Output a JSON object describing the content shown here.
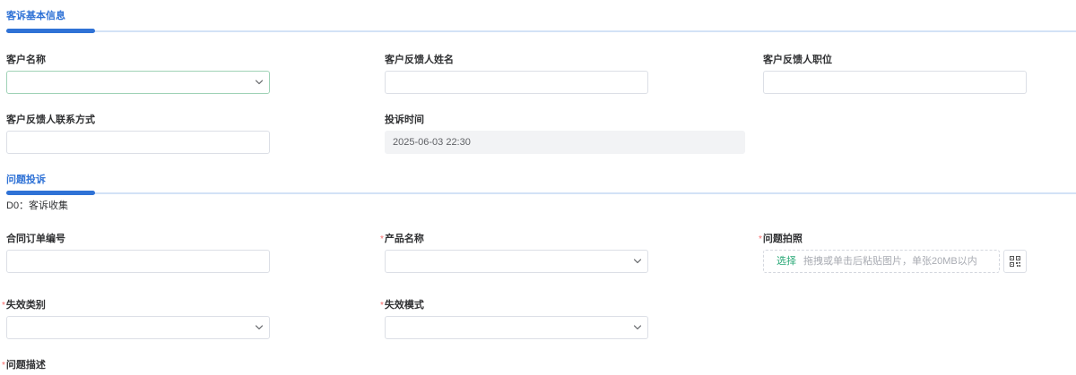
{
  "colors": {
    "accent": "#2f72d6",
    "divider": "#d3e2f6",
    "required": "#f56c6c",
    "upload_link": "#28a876",
    "placeholder": "#a8abb2",
    "disabled_bg": "#f2f3f5",
    "active_border": "#9fd2b6",
    "border": "#dcdfe6",
    "text": "#303133",
    "value_text": "#606266"
  },
  "icons": {
    "select_arrow": "chevron-down-icon",
    "scan_code": "qr-code-icon"
  },
  "required_mark": "*",
  "sections": [
    {
      "title": "客诉基本信息"
    },
    {
      "title": "问题投诉",
      "stage": "D0：客诉收集"
    }
  ],
  "basic": {
    "customer_name": {
      "label": "客户名称",
      "value": ""
    },
    "feedback_name": {
      "label": "客户反馈人姓名",
      "value": ""
    },
    "feedback_title": {
      "label": "客户反馈人职位",
      "value": ""
    },
    "feedback_contact": {
      "label": "客户反馈人联系方式",
      "value": ""
    },
    "complaint_time": {
      "label": "投诉时间",
      "value": "2025-06-03 22:30",
      "disabled": true
    }
  },
  "issue": {
    "contract_order_no": {
      "label": "合同订单编号",
      "value": ""
    },
    "product_name": {
      "label": "产品名称",
      "required": true,
      "value": ""
    },
    "issue_photo": {
      "label": "问题拍照",
      "required": true,
      "upload_action": "选择",
      "upload_hint": "拖拽或单击后粘贴图片，单张20MB以内"
    },
    "failure_category": {
      "label": "失效类别",
      "required": true,
      "value": ""
    },
    "failure_mode": {
      "label": "失效模式",
      "required": true,
      "value": ""
    },
    "issue_description": {
      "label": "问题描述",
      "required": true
    }
  }
}
